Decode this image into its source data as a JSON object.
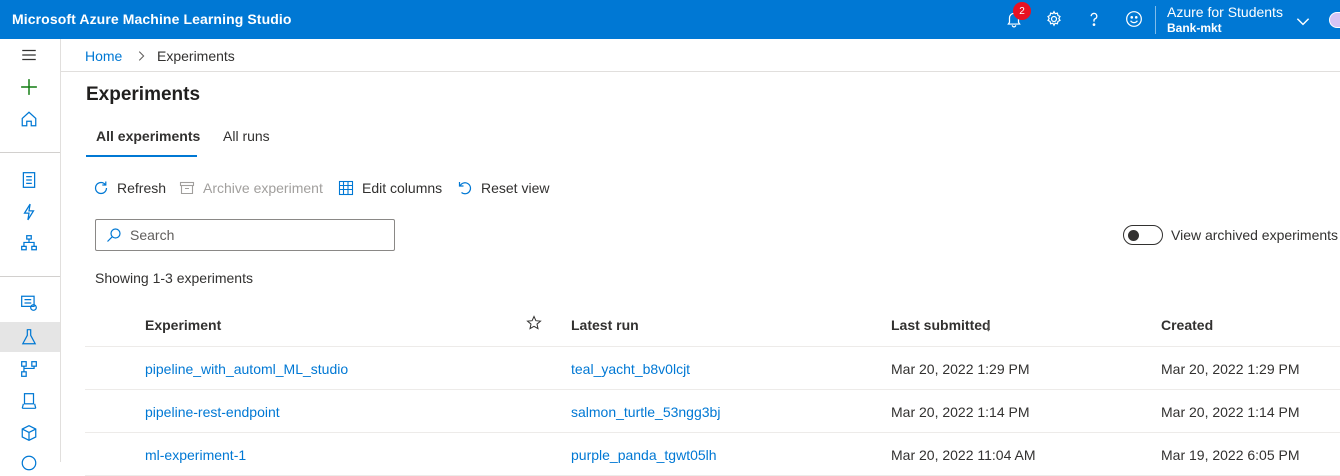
{
  "topbar": {
    "app_title": "Microsoft Azure Machine Learning Studio",
    "notification_count": "2",
    "subscription": "Azure for Students",
    "workspace": "Bank-mkt",
    "colors": {
      "bar": "#0078d4",
      "badge": "#e81123"
    }
  },
  "leftnav": {
    "icons": [
      "menu-icon",
      "create-new-icon",
      "home-icon",
      "notebooks-icon",
      "automated-ml-icon",
      "designer-icon",
      "datasets-icon",
      "experiments-icon",
      "pipelines-icon",
      "models-icon",
      "endpoints-icon"
    ],
    "active": "experiments-icon"
  },
  "breadcrumb": {
    "home": "Home",
    "separator": ">",
    "current": "Experiments"
  },
  "page": {
    "title": "Experiments"
  },
  "tabs": [
    {
      "label": "All experiments",
      "active": true
    },
    {
      "label": "All runs",
      "active": false
    }
  ],
  "toolbar": {
    "refresh": "Refresh",
    "archive": "Archive experiment",
    "edit_columns": "Edit columns",
    "reset_view": "Reset view"
  },
  "search": {
    "placeholder": "Search",
    "value": ""
  },
  "archived_toggle": {
    "label": "View archived experiments",
    "on": false
  },
  "showing": "Showing 1-3 experiments",
  "table": {
    "columns": [
      "Experiment",
      "Latest run",
      "Last submitted",
      "Created"
    ],
    "sort_indicator": "↓",
    "rows": [
      {
        "experiment": "pipeline_with_automl_ML_studio",
        "latest_run": "teal_yacht_b8v0lcjt",
        "last_submitted": "Mar 20, 2022 1:29 PM",
        "created": "Mar 20, 2022 1:29 PM"
      },
      {
        "experiment": "pipeline-rest-endpoint",
        "latest_run": "salmon_turtle_53ngg3bj",
        "last_submitted": "Mar 20, 2022 1:14 PM",
        "created": "Mar 20, 2022 1:14 PM"
      },
      {
        "experiment": "ml-experiment-1",
        "latest_run": "purple_panda_tgwt05lh",
        "last_submitted": "Mar 20, 2022 11:04 AM",
        "created": "Mar 19, 2022 6:05 PM"
      }
    ]
  }
}
